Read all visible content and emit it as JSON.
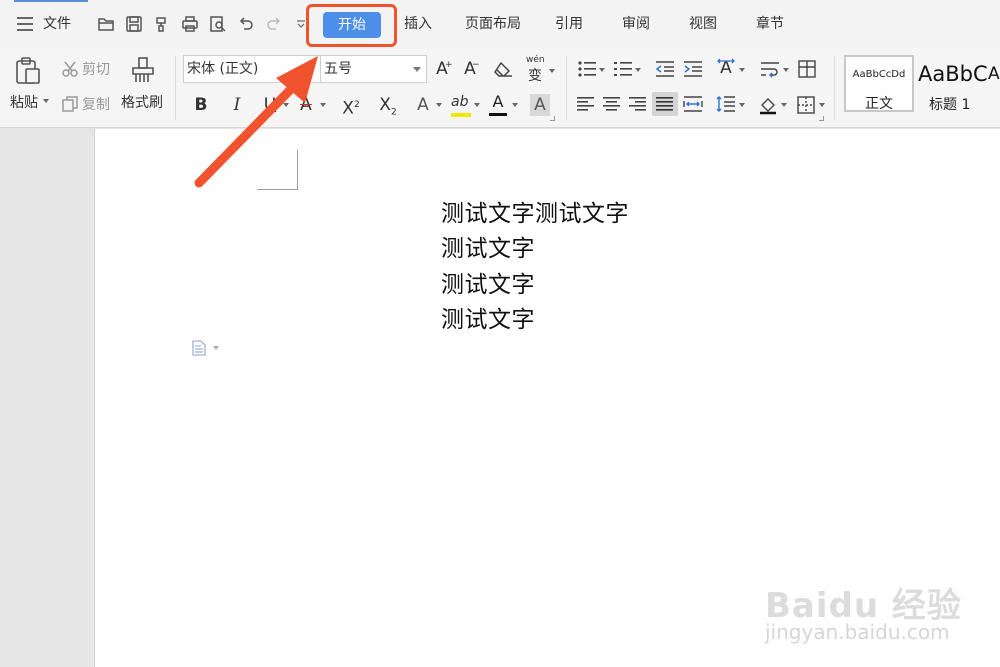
{
  "menubar": {
    "file_label": "文件",
    "tabs": [
      "开始",
      "插入",
      "页面布局",
      "引用",
      "审阅",
      "视图",
      "章节"
    ],
    "active_tab": "开始"
  },
  "quick_access_icons": [
    "open-icon",
    "save-icon",
    "format-painter-icon",
    "print-icon",
    "print-preview-icon",
    "undo-icon",
    "redo-icon",
    "customize-icon"
  ],
  "ribbon": {
    "paste_label": "粘贴",
    "cut_label": "剪切",
    "copy_label": "复制",
    "format_painter_label": "格式刷",
    "font_name": "宋体 (正文)",
    "font_size": "五号",
    "pinyin_label": "wén",
    "pinyin_char": "变",
    "format_buttons": {
      "bold": "B",
      "italic": "I",
      "underline": "U",
      "strikethrough": "A",
      "superscript": "X",
      "superscript_mark": "2",
      "subscript": "X",
      "subscript_mark": "2",
      "text_effect": "A",
      "highlight": "ab",
      "font_color": "A",
      "char_shading": "A",
      "grow_font": "A",
      "grow_mark": "+",
      "shrink_font": "A",
      "shrink_mark": "−",
      "text_direction": "A"
    },
    "styles": [
      {
        "sample": "AaBbCcDd",
        "name": "正文"
      },
      {
        "sample": "AaBbC",
        "name": "标题 1"
      }
    ],
    "styles_overflow_sample": "A"
  },
  "document": {
    "lines": [
      "测试文字测试文字",
      "测试文字",
      "测试文字",
      "测试文字"
    ]
  },
  "colors": {
    "accent": "#4d8ee8",
    "annotation": "#f0532d",
    "highlight_yellow": "#f5e800",
    "font_red": "#d62222"
  },
  "watermark": {
    "logo": "Baidu 经验",
    "url": "jingyan.baidu.com"
  }
}
